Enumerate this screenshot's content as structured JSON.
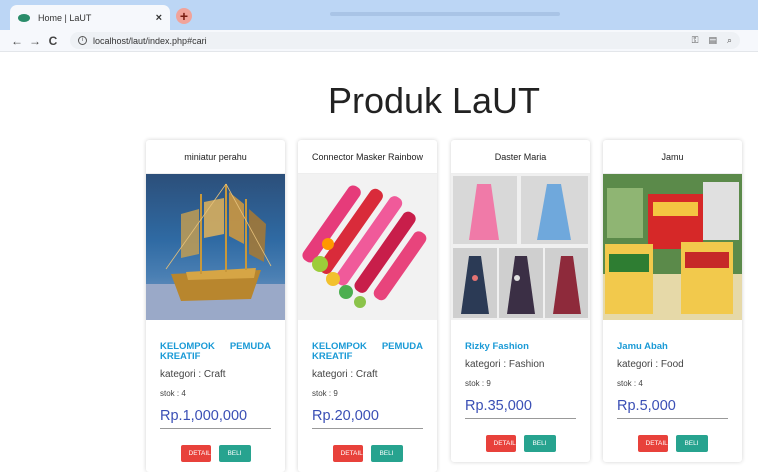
{
  "browser": {
    "tab_title": "Home | LaUT",
    "tab_close": "×",
    "new_tab": "+",
    "url": "localhost/laut/index.php#cari"
  },
  "page": {
    "title": "Produk LaUT"
  },
  "buttons": {
    "detail": "DETAIL",
    "beli": "BELI"
  },
  "products": [
    {
      "name": "miniatur perahu",
      "shop": "KELOMPOK PEMUDA KREATIF",
      "kategori": "kategori : Craft",
      "stok": "stok : 4",
      "price": "Rp.1,000,000"
    },
    {
      "name": "Connector Masker Rainbow",
      "shop": "KELOMPOK PEMUDA KREATIF",
      "kategori": "kategori : Craft",
      "stok": "stok : 9",
      "price": "Rp.20,000"
    },
    {
      "name": "Daster Maria",
      "shop": "Rizky Fashion",
      "kategori": "kategori : Fashion",
      "stok": "stok : 9",
      "price": "Rp.35,000"
    },
    {
      "name": "Jamu",
      "shop": "Jamu Abah",
      "kategori": "kategori : Food",
      "stok": "stok : 4",
      "price": "Rp.5,000"
    }
  ],
  "colors": {
    "shop_link": "#1a9ad6",
    "price": "#3a4fb5",
    "detail": "#e8413b",
    "beli": "#27a38f",
    "tabbar": "#bcd6f5"
  },
  "icons": [
    "back-arrow-icon",
    "forward-arrow-icon",
    "reload-icon",
    "info-icon",
    "key-icon",
    "reader-icon",
    "zoom-icon"
  ]
}
